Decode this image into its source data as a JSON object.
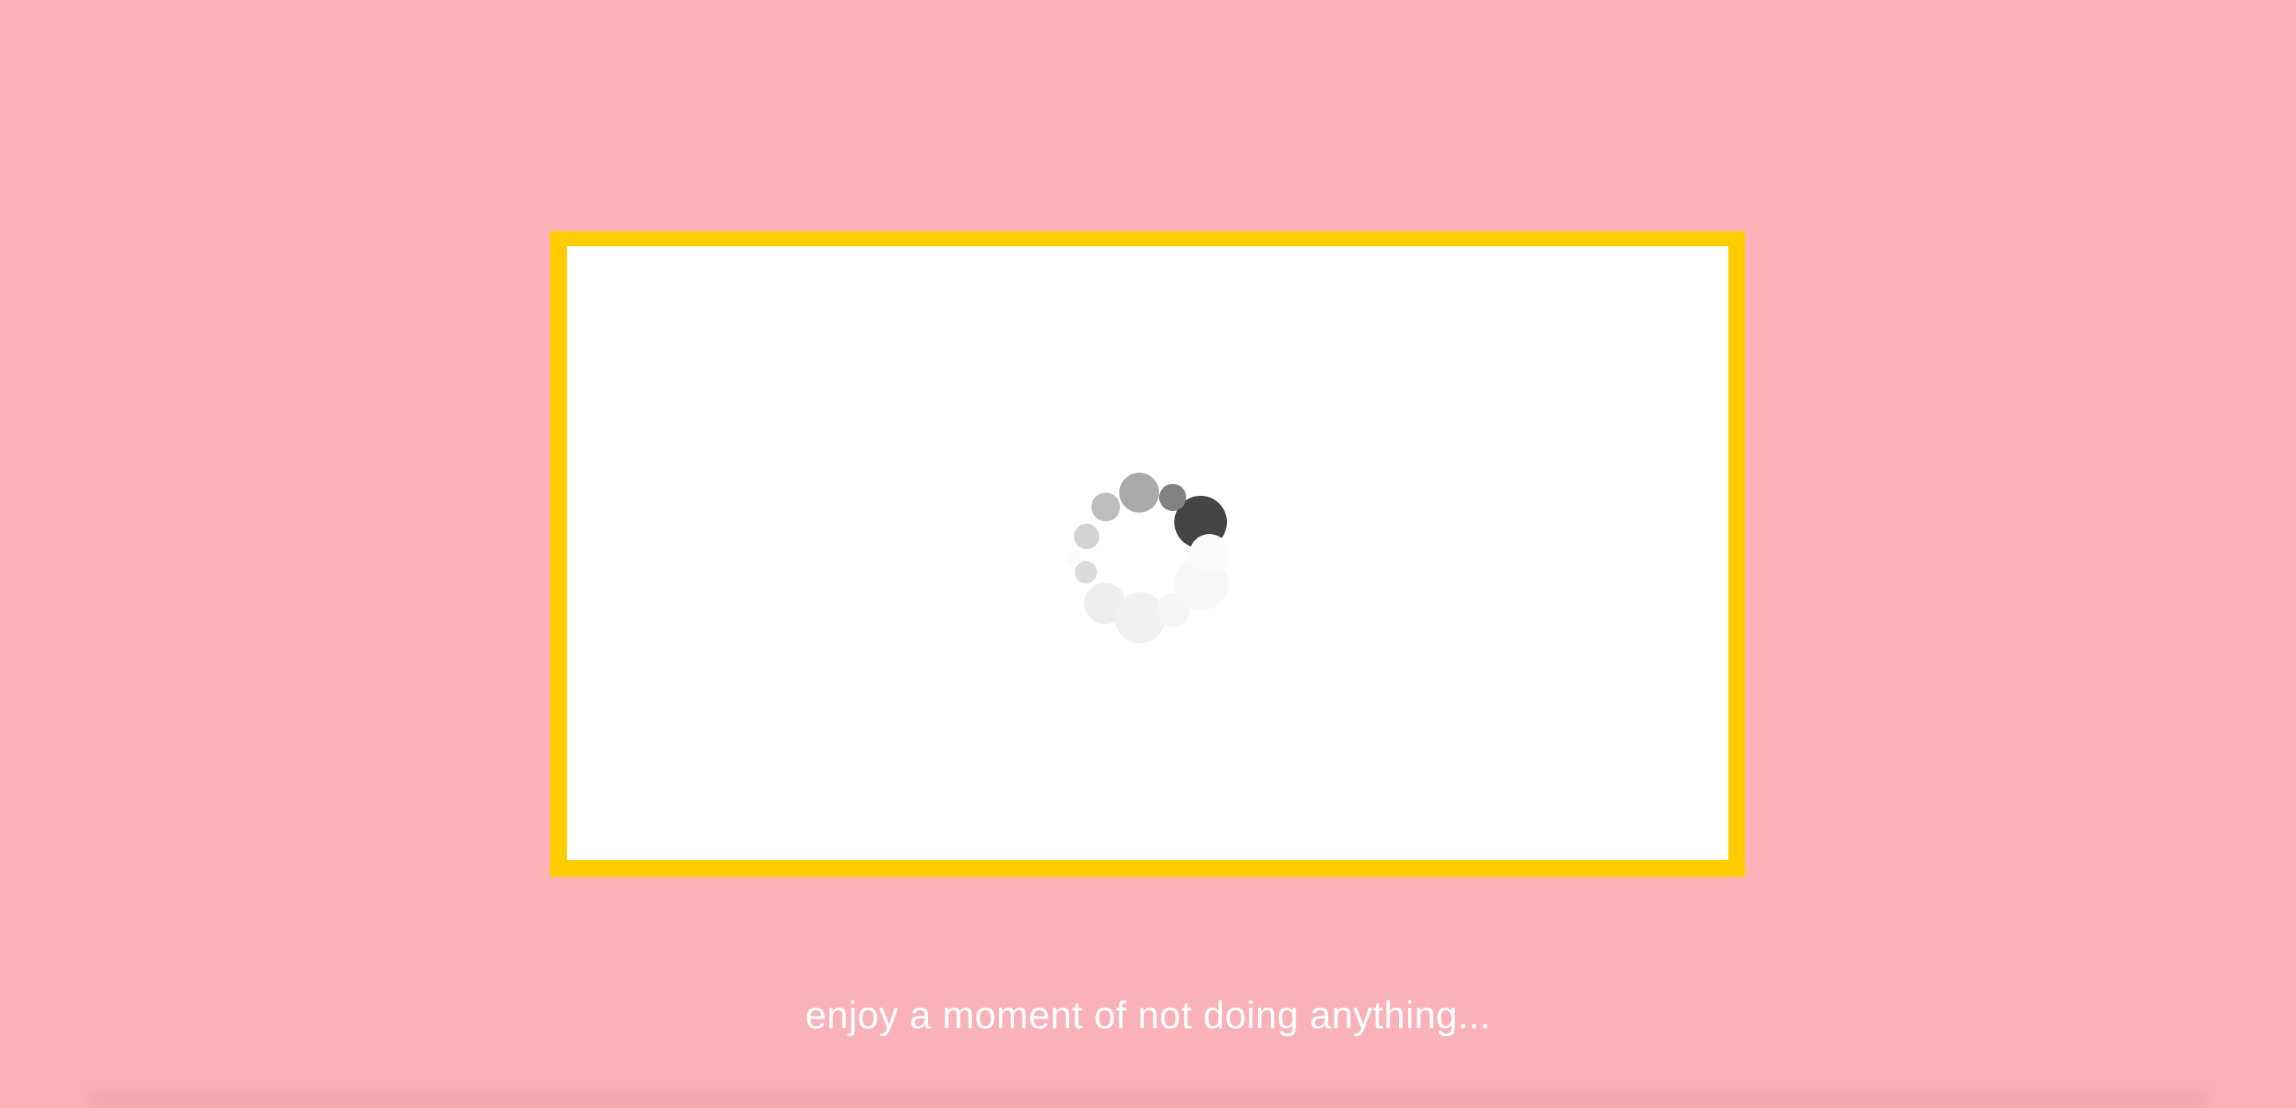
{
  "colors": {
    "background": "#f9b3b8",
    "frame_border": "#ffcc00",
    "frame_fill": "#ffffff",
    "caption_text": "#ffffff"
  },
  "loader": {
    "icon": "loading-spinner-icon",
    "dot_colors": [
      "#444444",
      "#828282",
      "#aaaaaa",
      "#bdbdbd",
      "#d3d3d3",
      "#dcdcdc",
      "#fcfcfc",
      "#eeeeee",
      "#f1f1f1",
      "#f5f5f5",
      "#f8f8f8",
      "#fbfbfb"
    ]
  },
  "message": {
    "text": "enjoy a moment of not doing anything..."
  }
}
